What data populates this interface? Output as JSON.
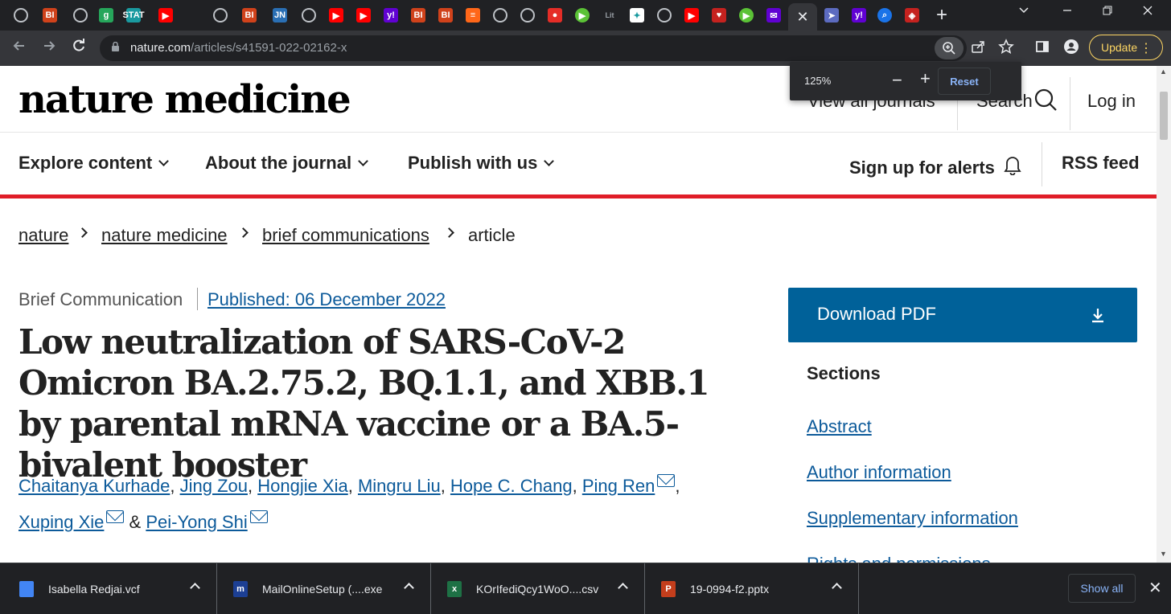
{
  "browser": {
    "tabs": [
      {
        "icon": "globe-icon",
        "color": "#3c4043"
      },
      {
        "icon": "bi-icon",
        "text": "BI",
        "color": "#d0421b"
      },
      {
        "icon": "globe-icon",
        "color": "#3c4043"
      },
      {
        "icon": "g-icon",
        "text": "g",
        "color": "#26a65b"
      },
      {
        "icon": "stat-icon",
        "text": "STAT",
        "color": "#1a9aa0"
      },
      {
        "icon": "youtube-icon",
        "color": "#ff0000"
      },
      {
        "icon": "globe-icon",
        "color": "#3c4043"
      },
      {
        "icon": "bi-icon",
        "text": "BI",
        "color": "#d0421b"
      },
      {
        "icon": "jn-icon",
        "text": "JN",
        "color": "#2a6fb4"
      },
      {
        "icon": "globe-icon",
        "color": "#3c4043"
      },
      {
        "icon": "youtube-icon",
        "color": "#ff0000"
      },
      {
        "icon": "youtube-icon",
        "color": "#ff0000"
      },
      {
        "icon": "yahoo-icon",
        "text": "y!",
        "color": "#6001d2"
      },
      {
        "icon": "bi-icon",
        "text": "BI",
        "color": "#d0421b"
      },
      {
        "icon": "bi-icon",
        "text": "BI",
        "color": "#d0421b"
      },
      {
        "icon": "substack-icon",
        "color": "#ff6719"
      },
      {
        "icon": "globe-icon",
        "color": "#3c4043"
      },
      {
        "icon": "globe-icon",
        "color": "#3c4043"
      },
      {
        "icon": "podcast-icon",
        "color": "#e52d27"
      },
      {
        "icon": "play-icon",
        "color": "#5bc236"
      },
      {
        "icon": "lit-icon",
        "color": "#9aa0a6"
      },
      {
        "icon": "puzzle-icon",
        "color": "#ffffff"
      },
      {
        "icon": "globe-icon",
        "color": "#3c4043"
      },
      {
        "icon": "youtube-icon",
        "color": "#ff0000"
      },
      {
        "icon": "heart-icon",
        "color": "#c5221f"
      },
      {
        "icon": "play-icon",
        "color": "#5bc236"
      },
      {
        "icon": "mail-icon",
        "color": "#6001d2"
      },
      {
        "icon": "close-icon",
        "active": true
      },
      {
        "icon": "arrow-icon",
        "color": "#5c6bc0"
      },
      {
        "icon": "yahoo-icon",
        "text": "y!",
        "color": "#6001d2"
      },
      {
        "icon": "search-icon",
        "color": "#1a73e8"
      },
      {
        "icon": "shield-icon",
        "color": "#c5221f"
      }
    ],
    "url_domain": "nature.com",
    "url_path": "/articles/s41591-022-02162-x",
    "update_label": "Update",
    "zoom": {
      "level": "125%",
      "reset_label": "Reset"
    }
  },
  "site": {
    "logo": "nature medicine",
    "header_links": {
      "journals": "View all journals",
      "search": "Search",
      "login": "Log in"
    },
    "nav": {
      "explore": "Explore content",
      "about": "About the journal",
      "publish": "Publish with us",
      "alerts": "Sign up for alerts",
      "rss": "RSS feed"
    },
    "breadcrumb": [
      "nature",
      "nature medicine",
      "brief communications",
      "article"
    ]
  },
  "article": {
    "type": "Brief Communication",
    "published": "Published: 06 December 2022",
    "title": "Low neutralization of SARS-CoV-2 Omicron BA.2.75.2, BQ.1.1, and XBB.1 by parental mRNA vaccine or a BA.5-bivalent booster",
    "authors": [
      {
        "name": "Chaitanya Kurhade",
        "mail": false
      },
      {
        "name": "Jing Zou",
        "mail": false
      },
      {
        "name": "Hongjie Xia",
        "mail": false
      },
      {
        "name": "Mingru Liu",
        "mail": false
      },
      {
        "name": "Hope C. Chang",
        "mail": false
      },
      {
        "name": "Ping Ren",
        "mail": true
      },
      {
        "name": "Xuping Xie",
        "mail": true
      },
      {
        "name": "Pei-Yong Shi",
        "mail": true
      }
    ],
    "author_sep": ",",
    "author_amp": "&"
  },
  "sidebar": {
    "download_label": "Download PDF",
    "sections_heading": "Sections",
    "links": [
      "Abstract",
      "Author information",
      "Supplementary information",
      "Rights and permissions"
    ]
  },
  "downloads": {
    "items": [
      {
        "name": "Isabella Redjai.vcf",
        "icon": "contact-icon",
        "color": "#4285f4"
      },
      {
        "name": "MailOnlineSetup (....exe",
        "icon": "installer-icon",
        "color": "#1c3f94",
        "text": "m"
      },
      {
        "name": "KOrIfediQcy1WoO....csv",
        "icon": "excel-icon",
        "color": "#1e7145",
        "text": "x"
      },
      {
        "name": "19-0994-f2.pptx",
        "icon": "powerpoint-icon",
        "color": "#c43e1c",
        "text": "P"
      }
    ],
    "show_all": "Show all"
  }
}
